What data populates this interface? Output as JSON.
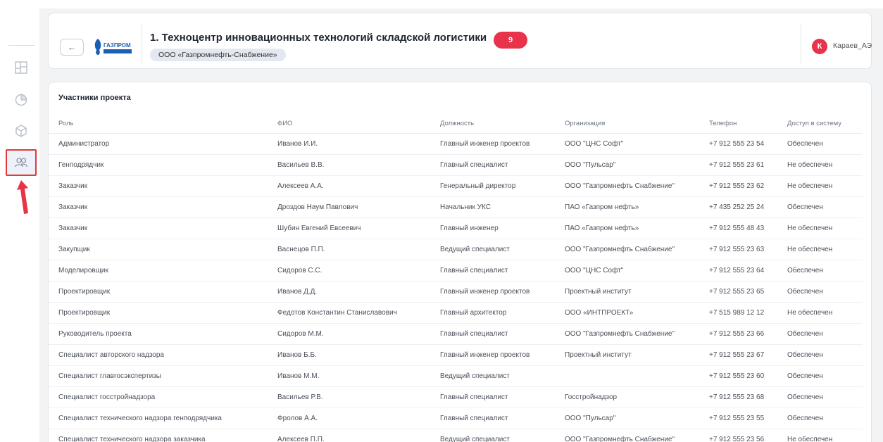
{
  "header": {
    "back_icon": "arrow-left-icon",
    "logo_text": "ГАЗПРОМ",
    "title": "1. Техноцентр инновационных технологий складской логистики",
    "count": "9",
    "organization": "ООО «Газпромнефть-Снабжение»",
    "user_initial": "К",
    "user_name": "Караев_АЭ"
  },
  "sidebar": {
    "items": [
      {
        "icon": "layout-icon",
        "active": false
      },
      {
        "icon": "pie-chart-icon",
        "active": false
      },
      {
        "icon": "cube-icon",
        "active": false
      },
      {
        "icon": "users-icon",
        "active": true
      }
    ]
  },
  "participants": {
    "title": "Участники проекта",
    "columns": [
      "Роль",
      "ФИО",
      "Должность",
      "Организация",
      "Телефон",
      "Доступ в систему"
    ],
    "rows": [
      [
        "Администратор",
        "Иванов И.И.",
        "Главный инженер проектов",
        "ООО \"ЦНС Софт\"",
        "+7 912 555 23 54",
        "Обеспечен"
      ],
      [
        "Генподрядчик",
        "Васильев В.В.",
        "Главный специалист",
        "ООО \"Пульсар\"",
        "+7 912 555 23 61",
        "Не обеспечен"
      ],
      [
        "Заказчик",
        "Алексеев А.А.",
        "Генеральный директор",
        "ООО \"Газпромнефть Снабжение\"",
        "+7 912 555 23 62",
        "Не обеспечен"
      ],
      [
        "Заказчик",
        "Дроздов Наум Павлович",
        "Начальник УКС",
        "ПАО «Газпром нефть»",
        "+7 435 252 25 24",
        "Обеспечен"
      ],
      [
        "Заказчик",
        "Шубин Евгений Евсеевич",
        "Главный инженер",
        "ПАО «Газпром нефть»",
        "+7 912 555 48 43",
        "Не обеспечен"
      ],
      [
        "Закупщик",
        "Васнецов П.П.",
        "Ведущий специалист",
        "ООО \"Газпромнефть Снабжение\"",
        "+7 912 555 23 63",
        "Не обеспечен"
      ],
      [
        "Моделировщик",
        "Сидоров С.С.",
        "Главный специалист",
        "ООО \"ЦНС Софт\"",
        "+7 912 555 23 64",
        "Обеспечен"
      ],
      [
        "Проектировщик",
        "Иванов Д.Д.",
        "Главный инженер проектов",
        "Проектный институт",
        "+7 912 555 23 65",
        "Обеспечен"
      ],
      [
        "Проектировщик",
        "Федотов Константин Станиславович",
        "Главный архитектор",
        "ООО «ИНТПРОЕКТ»",
        "+7 515 989 12 12",
        "Не обеспечен"
      ],
      [
        "Руководитель проекта",
        "Сидоров М.М.",
        "Главный специалист",
        "ООО \"Газпромнефть Снабжение\"",
        "+7 912 555 23 66",
        "Обеспечен"
      ],
      [
        "Специалист авторского надзора",
        "Иванов Б.Б.",
        "Главный инженер проектов",
        "Проектный институт",
        "+7 912 555 23 67",
        "Обеспечен"
      ],
      [
        "Специалист главгосэкспертизы",
        "Иванов М.М.",
        "Ведущий специалист",
        "",
        "+7 912 555 23 60",
        "Обеспечен"
      ],
      [
        "Специалист госстройнадзора",
        "Васильев Р.В.",
        "Главный специалист",
        "Госстройнадзор",
        "+7 912 555 23 68",
        "Обеспечен"
      ],
      [
        "Специалист технического надзора генподрядчика",
        "Фролов А.А.",
        "Главный специалист",
        "ООО \"Пульсар\"",
        "+7 912 555 23 55",
        "Обеспечен"
      ],
      [
        "Специалист технического надзора заказчика",
        "Алексеев П.П.",
        "Ведущий специалист",
        "ООО \"Газпромнефть Снабжение\"",
        "+7 912 555 23 56",
        "Не обеспечен"
      ]
    ]
  },
  "colors": {
    "accent_red": "#e8334a",
    "highlight_border": "#e03a3a",
    "logo_blue": "#1a5fb4"
  }
}
